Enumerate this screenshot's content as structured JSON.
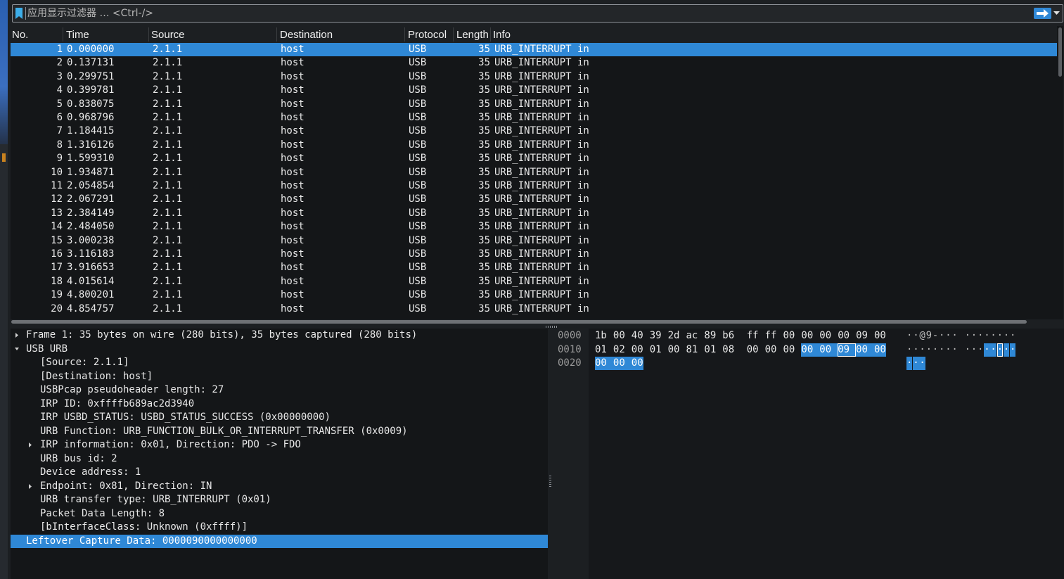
{
  "filter": {
    "placeholder": "应用显示过滤器 … <Ctrl-/>",
    "bookmark_icon": "bookmark-icon",
    "apply_icon": "arrow-right-icon",
    "dropdown_icon": "chevron-down-icon"
  },
  "colors": {
    "selection": "#2f88d6",
    "background": "#141618",
    "header": "#1c1f22",
    "text": "#e8e8e8"
  },
  "packet_list": {
    "columns": [
      "No.",
      "Time",
      "Source",
      "Destination",
      "Protocol",
      "Length",
      "Info"
    ],
    "selected_row": 0,
    "rows": [
      {
        "no": "1",
        "time": "0.000000",
        "source": "2.1.1",
        "destination": "host",
        "protocol": "USB",
        "length": "35",
        "info": "URB_INTERRUPT in"
      },
      {
        "no": "2",
        "time": "0.137131",
        "source": "2.1.1",
        "destination": "host",
        "protocol": "USB",
        "length": "35",
        "info": "URB_INTERRUPT in"
      },
      {
        "no": "3",
        "time": "0.299751",
        "source": "2.1.1",
        "destination": "host",
        "protocol": "USB",
        "length": "35",
        "info": "URB_INTERRUPT in"
      },
      {
        "no": "4",
        "time": "0.399781",
        "source": "2.1.1",
        "destination": "host",
        "protocol": "USB",
        "length": "35",
        "info": "URB_INTERRUPT in"
      },
      {
        "no": "5",
        "time": "0.838075",
        "source": "2.1.1",
        "destination": "host",
        "protocol": "USB",
        "length": "35",
        "info": "URB_INTERRUPT in"
      },
      {
        "no": "6",
        "time": "0.968796",
        "source": "2.1.1",
        "destination": "host",
        "protocol": "USB",
        "length": "35",
        "info": "URB_INTERRUPT in"
      },
      {
        "no": "7",
        "time": "1.184415",
        "source": "2.1.1",
        "destination": "host",
        "protocol": "USB",
        "length": "35",
        "info": "URB_INTERRUPT in"
      },
      {
        "no": "8",
        "time": "1.316126",
        "source": "2.1.1",
        "destination": "host",
        "protocol": "USB",
        "length": "35",
        "info": "URB_INTERRUPT in"
      },
      {
        "no": "9",
        "time": "1.599310",
        "source": "2.1.1",
        "destination": "host",
        "protocol": "USB",
        "length": "35",
        "info": "URB_INTERRUPT in"
      },
      {
        "no": "10",
        "time": "1.934871",
        "source": "2.1.1",
        "destination": "host",
        "protocol": "USB",
        "length": "35",
        "info": "URB_INTERRUPT in"
      },
      {
        "no": "11",
        "time": "2.054854",
        "source": "2.1.1",
        "destination": "host",
        "protocol": "USB",
        "length": "35",
        "info": "URB_INTERRUPT in"
      },
      {
        "no": "12",
        "time": "2.067291",
        "source": "2.1.1",
        "destination": "host",
        "protocol": "USB",
        "length": "35",
        "info": "URB_INTERRUPT in"
      },
      {
        "no": "13",
        "time": "2.384149",
        "source": "2.1.1",
        "destination": "host",
        "protocol": "USB",
        "length": "35",
        "info": "URB_INTERRUPT in"
      },
      {
        "no": "14",
        "time": "2.484050",
        "source": "2.1.1",
        "destination": "host",
        "protocol": "USB",
        "length": "35",
        "info": "URB_INTERRUPT in"
      },
      {
        "no": "15",
        "time": "3.000238",
        "source": "2.1.1",
        "destination": "host",
        "protocol": "USB",
        "length": "35",
        "info": "URB_INTERRUPT in"
      },
      {
        "no": "16",
        "time": "3.116183",
        "source": "2.1.1",
        "destination": "host",
        "protocol": "USB",
        "length": "35",
        "info": "URB_INTERRUPT in"
      },
      {
        "no": "17",
        "time": "3.916653",
        "source": "2.1.1",
        "destination": "host",
        "protocol": "USB",
        "length": "35",
        "info": "URB_INTERRUPT in"
      },
      {
        "no": "18",
        "time": "4.015614",
        "source": "2.1.1",
        "destination": "host",
        "protocol": "USB",
        "length": "35",
        "info": "URB_INTERRUPT in"
      },
      {
        "no": "19",
        "time": "4.800201",
        "source": "2.1.1",
        "destination": "host",
        "protocol": "USB",
        "length": "35",
        "info": "URB_INTERRUPT in"
      },
      {
        "no": "20",
        "time": "4.854757",
        "source": "2.1.1",
        "destination": "host",
        "protocol": "USB",
        "length": "35",
        "info": "URB_INTERRUPT in"
      }
    ]
  },
  "details": {
    "selected_row": 15,
    "rows": [
      {
        "indent": 0,
        "expander": "collapsed",
        "text": "Frame 1: 35 bytes on wire (280 bits), 35 bytes captured (280 bits)"
      },
      {
        "indent": 0,
        "expander": "expanded",
        "text": "USB URB"
      },
      {
        "indent": 1,
        "expander": "none",
        "text": "[Source: 2.1.1]"
      },
      {
        "indent": 1,
        "expander": "none",
        "text": "[Destination: host]"
      },
      {
        "indent": 1,
        "expander": "none",
        "text": "USBPcap pseudoheader length: 27"
      },
      {
        "indent": 1,
        "expander": "none",
        "text": "IRP ID: 0xffffb689ac2d3940"
      },
      {
        "indent": 1,
        "expander": "none",
        "text": "IRP USBD_STATUS: USBD_STATUS_SUCCESS (0x00000000)"
      },
      {
        "indent": 1,
        "expander": "none",
        "text": "URB Function: URB_FUNCTION_BULK_OR_INTERRUPT_TRANSFER (0x0009)"
      },
      {
        "indent": 1,
        "expander": "collapsed",
        "text": "IRP information: 0x01, Direction: PDO -> FDO"
      },
      {
        "indent": 1,
        "expander": "none",
        "text": "URB bus id: 2"
      },
      {
        "indent": 1,
        "expander": "none",
        "text": "Device address: 1"
      },
      {
        "indent": 1,
        "expander": "collapsed",
        "text": "Endpoint: 0x81, Direction: IN"
      },
      {
        "indent": 1,
        "expander": "none",
        "text": "URB transfer type: URB_INTERRUPT (0x01)"
      },
      {
        "indent": 1,
        "expander": "none",
        "text": "Packet Data Length: 8"
      },
      {
        "indent": 1,
        "expander": "none",
        "text": "[bInterfaceClass: Unknown (0xffff)]"
      },
      {
        "indent": 0,
        "expander": "none",
        "text": "Leftover Capture Data: 0000090000000000"
      }
    ]
  },
  "hex": {
    "rows": [
      {
        "offset": "0000",
        "bytes": [
          "1b",
          "00",
          "40",
          "39",
          "2d",
          "ac",
          "89",
          "b6",
          "ff",
          "ff",
          "00",
          "00",
          "00",
          "00",
          "09",
          "00"
        ],
        "ascii": [
          "·",
          "·",
          "@",
          "9",
          "-",
          "·",
          "·",
          "·",
          "·",
          "·",
          "·",
          "·",
          "·",
          "·",
          "·",
          "·"
        ]
      },
      {
        "offset": "0010",
        "bytes": [
          "01",
          "02",
          "00",
          "01",
          "00",
          "81",
          "01",
          "08",
          "00",
          "00",
          "00",
          "00",
          "00",
          "09",
          "00",
          "00"
        ],
        "ascii": [
          "·",
          "·",
          "·",
          "·",
          "·",
          "·",
          "·",
          "·",
          "·",
          "·",
          "·",
          "·",
          "·",
          "·",
          "·",
          "·"
        ]
      },
      {
        "offset": "0020",
        "bytes": [
          "00",
          "00",
          "00"
        ],
        "ascii": [
          "·",
          "·",
          "·"
        ]
      }
    ],
    "highlight_start": 27,
    "highlight_end": 34,
    "cursor": 29
  }
}
